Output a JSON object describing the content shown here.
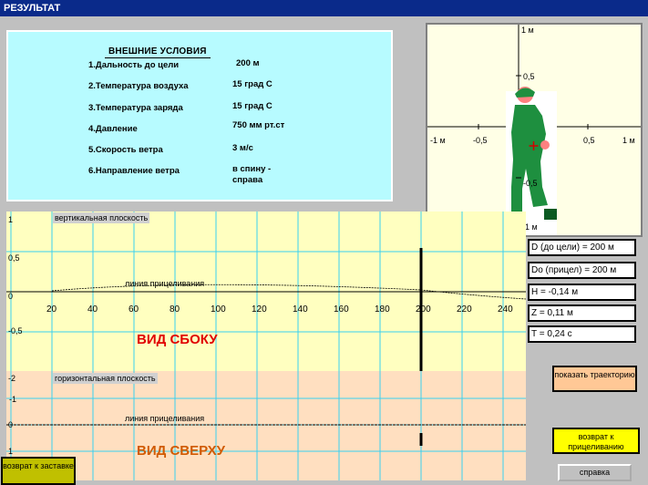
{
  "window": {
    "title": "РЕЗУЛЬТАТ"
  },
  "conditions": {
    "title": "ВНЕШНИЕ УСЛОВИЯ",
    "rows": [
      {
        "label": "1.Дальность до цели",
        "value": "200 м"
      },
      {
        "label": "2.Температура воздуха",
        "value": "15 град С"
      },
      {
        "label": "3.Температура заряда",
        "value": "15 град С"
      },
      {
        "label": "4.Давление",
        "value": "750 мм рт.ст"
      },
      {
        "label": "5.Скорость ветра",
        "value": "3 м/с"
      },
      {
        "label": "6.Направление ветра",
        "value": "в спину -\nсправа"
      }
    ]
  },
  "target": {
    "ticks": {
      "top": "1 м",
      "right": "1 м",
      "left": "-1 м",
      "bottom": "-1 м",
      "up_half": "0,5",
      "right_half": "0,5",
      "left_half": "-0,5",
      "down_half": "-0,5"
    },
    "hit": {
      "x": 0.11,
      "y": -0.14
    },
    "colors": {
      "soldier": "#1e8f3f",
      "skin": "#ff8080",
      "boots": "#0b5a22"
    }
  },
  "side_view": {
    "plane_label": "вертикальная плоскость",
    "aim_line_label": "линия прицеливания",
    "title": "ВИД СБОКУ",
    "y_ticks": [
      "1",
      "0,5",
      "0",
      "-0,5"
    ],
    "x_ticks": [
      "20",
      "40",
      "60",
      "80",
      "100",
      "120",
      "140",
      "160",
      "180",
      "200",
      "220",
      "240"
    ],
    "target_distance": 200
  },
  "top_view": {
    "plane_label": "горизонтальная плоскость",
    "aim_line_label": "линия прицеливания",
    "title": "ВИД СВЕРХУ",
    "y_ticks": [
      "-2",
      "-1",
      "0",
      "1"
    ]
  },
  "results": {
    "distance": "D (до цели) = 200 м",
    "sight": "Do (прицел) = 200 м",
    "height": "H = -0,14 м",
    "lateral": "Z = 0,11 м",
    "time": "T = 0,24 с"
  },
  "buttons": {
    "show_trajectory": "показать траекторию",
    "back_to_aim": "возврат к прицеливанию",
    "help": "справка",
    "back_to_splash": "возврат к заставке"
  },
  "colors": {
    "title_bar": "#0a2a8a",
    "conditions_bg": "#b7fbff",
    "side_bg": "#ffffc0",
    "top_bg": "#ffdfc0",
    "grid": "#3ad0f0",
    "side_title": "#e00000",
    "top_title": "#d05a00"
  }
}
